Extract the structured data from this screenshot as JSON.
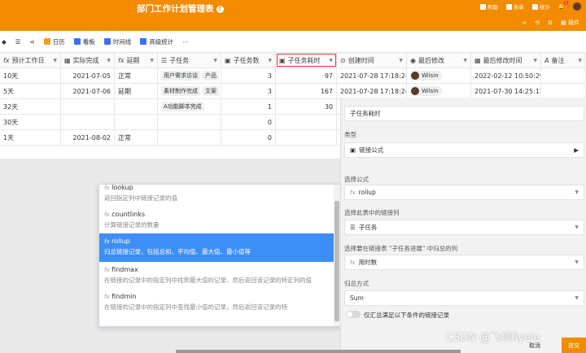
{
  "app": {
    "title": "部门工作计划管理表",
    "help_glyph": "?"
  },
  "toplinks": [
    {
      "label": "帮助",
      "icon": "help-icon"
    },
    {
      "label": "表单",
      "icon": "form-icon"
    },
    {
      "label": "统计",
      "icon": "chart-icon"
    },
    {
      "label": "插件",
      "icon": "plugin-icon"
    }
  ],
  "notify_count": "1",
  "toolbar": [
    {
      "label": "日历",
      "color": "#f0a020"
    },
    {
      "label": "看板",
      "color": "#3e6ef7"
    },
    {
      "label": "时间线",
      "color": "#3e6ef7"
    },
    {
      "label": "高级统计",
      "color": "#3e6ef7"
    }
  ],
  "columns": [
    {
      "label": "预计工作日",
      "icon": "fx"
    },
    {
      "label": "实际完成",
      "icon": "▦"
    },
    {
      "label": "延期",
      "icon": "fx"
    },
    {
      "label": "子任务",
      "icon": "☰"
    },
    {
      "label": "子任务数",
      "icon": "▣"
    },
    {
      "label": "子任务耗时",
      "icon": "▣"
    },
    {
      "label": "创建时间",
      "icon": "⊙"
    },
    {
      "label": "最后修改",
      "icon": "◉"
    },
    {
      "label": "最后修改时间",
      "icon": "▦"
    },
    {
      "label": "备注",
      "icon": "A"
    }
  ],
  "rows": [
    {
      "c1": "10天",
      "c2": "2021-07-05",
      "c3": "正常",
      "tags": [
        "用户需求访谈",
        "产品"
      ],
      "c5": "3",
      "c6": "97",
      "c7": "2021-07-28 17:18:24",
      "user": "Wilsin",
      "c9": "2022-02-12 10:50:29",
      "c10": ""
    },
    {
      "c1": "5天",
      "c2": "2021-07-06",
      "c3": "延期",
      "tags": [
        "素材制作完成",
        "文案"
      ],
      "c5": "3",
      "c6": "167",
      "c7": "2021-07-28 17:18:24",
      "user": "Wilsin",
      "c9": "2021-07-30 14:25:12",
      "c10": ""
    },
    {
      "c1": "32天",
      "c2": "",
      "c3": "",
      "tags": [
        "A功能脚本完成"
      ],
      "c5": "1",
      "c6": "30",
      "c7": "",
      "user": "",
      "c9": "",
      "c10": ""
    },
    {
      "c1": "30天",
      "c2": "",
      "c3": "",
      "tags": [],
      "c5": "0",
      "c6": "",
      "c7": "",
      "user": "",
      "c9": "",
      "c10": ""
    },
    {
      "c1": "1天",
      "c2": "2021-08-02",
      "c3": "正常",
      "tags": [],
      "c5": "0",
      "c6": "",
      "c7": "",
      "user": "",
      "c9": "",
      "c10": ""
    }
  ],
  "dropdown": [
    {
      "name": "lookup",
      "desc": "返回指定列中链接记录的值",
      "selected": false
    },
    {
      "name": "countlinks",
      "desc": "计算链接记录的数量",
      "selected": false
    },
    {
      "name": "rollup",
      "desc": "归总链接记录，包括总和、平均值、最大值、最小值等",
      "selected": true
    },
    {
      "name": "findmax",
      "desc": "在链接的记录中的指定列中找到最大值的记录，然后返回该记录的特定列的值",
      "selected": false
    },
    {
      "name": "findmin",
      "desc": "在链接的记录中的指定列中查找最小值的记录，然后返回该记录的特",
      "selected": false
    }
  ],
  "panel": {
    "field_name": "子任务耗时",
    "type_label": "类型",
    "type_value": "链接公式",
    "formula_label": "选择公式",
    "formula_value": "rollup",
    "link_label": "选择此表中的链接列",
    "link_value": "子任务",
    "agg_col_label": "选择要在链接表 \"子任务进展\" 中归总的列",
    "agg_col_value": "用时数",
    "method_label": "归总方式",
    "method_value": "Sum",
    "toggle_label": "仅汇总满足以下条件的链接记录",
    "cancel": "取消",
    "submit": "提交"
  },
  "watermark": "CSDN @飞项flyele"
}
